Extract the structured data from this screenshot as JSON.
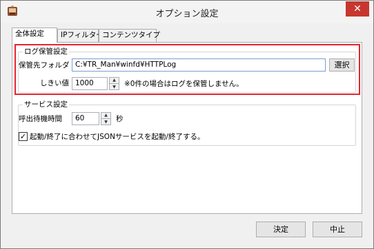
{
  "window": {
    "title": "オプション設定",
    "close_glyph": "✕"
  },
  "tabs": [
    {
      "label": "全体設定",
      "active": true
    },
    {
      "label": "IPフィルター",
      "active": false
    },
    {
      "label": "コンテンツタイプ",
      "active": false
    }
  ],
  "log_group": {
    "legend": "ログ保管設定",
    "folder_label": "保管先フォルダ",
    "folder_value": "C:¥TR_Man¥winfd¥HTTPLog",
    "select_button": "選択",
    "threshold_label": "しきい値",
    "threshold_value": "1000",
    "threshold_note": "※0件の場合はログを保管しません。"
  },
  "service_group": {
    "legend": "サービス設定",
    "wait_label": "呼出待機時間",
    "wait_value": "60",
    "wait_unit": "秒",
    "json_checkbox_label": "起動/終了に合わせてJSONサービスを起動/終了する。",
    "json_checkbox_checked": true
  },
  "footer": {
    "ok_button": "決定",
    "cancel_button": "中止"
  },
  "colors": {
    "highlight": "#e8232f",
    "close": "#c7372f"
  },
  "icons": {
    "app": "app-icon",
    "close": "close-icon",
    "spin_up": "spin-up-icon",
    "spin_down": "spin-down-icon",
    "check": "checkmark-icon"
  }
}
